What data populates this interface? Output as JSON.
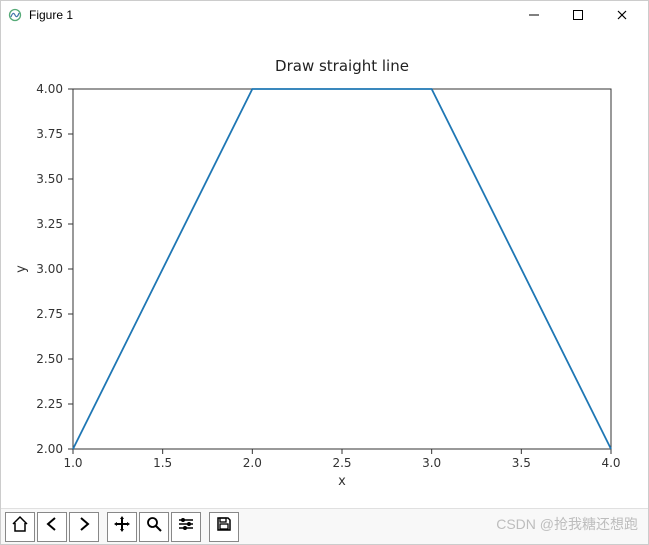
{
  "window": {
    "title": "Figure 1",
    "controls": {
      "minimize": "-",
      "maximize": "□",
      "close": "×"
    }
  },
  "chart_data": {
    "type": "line",
    "x": [
      1,
      2,
      3,
      4
    ],
    "y": [
      2,
      4,
      4,
      2
    ],
    "title": "Draw  straight line",
    "xlabel": "x",
    "ylabel": "y",
    "xticks": [
      1.0,
      1.5,
      2.0,
      2.5,
      3.0,
      3.5,
      4.0
    ],
    "yticks": [
      2.0,
      2.25,
      2.5,
      2.75,
      3.0,
      3.25,
      3.5,
      3.75,
      4.0
    ],
    "xlim": [
      1.0,
      4.0
    ],
    "ylim": [
      2.0,
      4.0
    ],
    "line_color": "#1f77b4"
  },
  "toolbar": {
    "buttons": [
      {
        "name": "home",
        "label": "Home"
      },
      {
        "name": "back",
        "label": "Back"
      },
      {
        "name": "forward",
        "label": "Forward"
      },
      {
        "name": "pan",
        "label": "Pan"
      },
      {
        "name": "zoom",
        "label": "Zoom"
      },
      {
        "name": "subplots",
        "label": "Configure subplots"
      },
      {
        "name": "save",
        "label": "Save"
      }
    ]
  },
  "watermark": "CSDN @抢我糖还想跑"
}
